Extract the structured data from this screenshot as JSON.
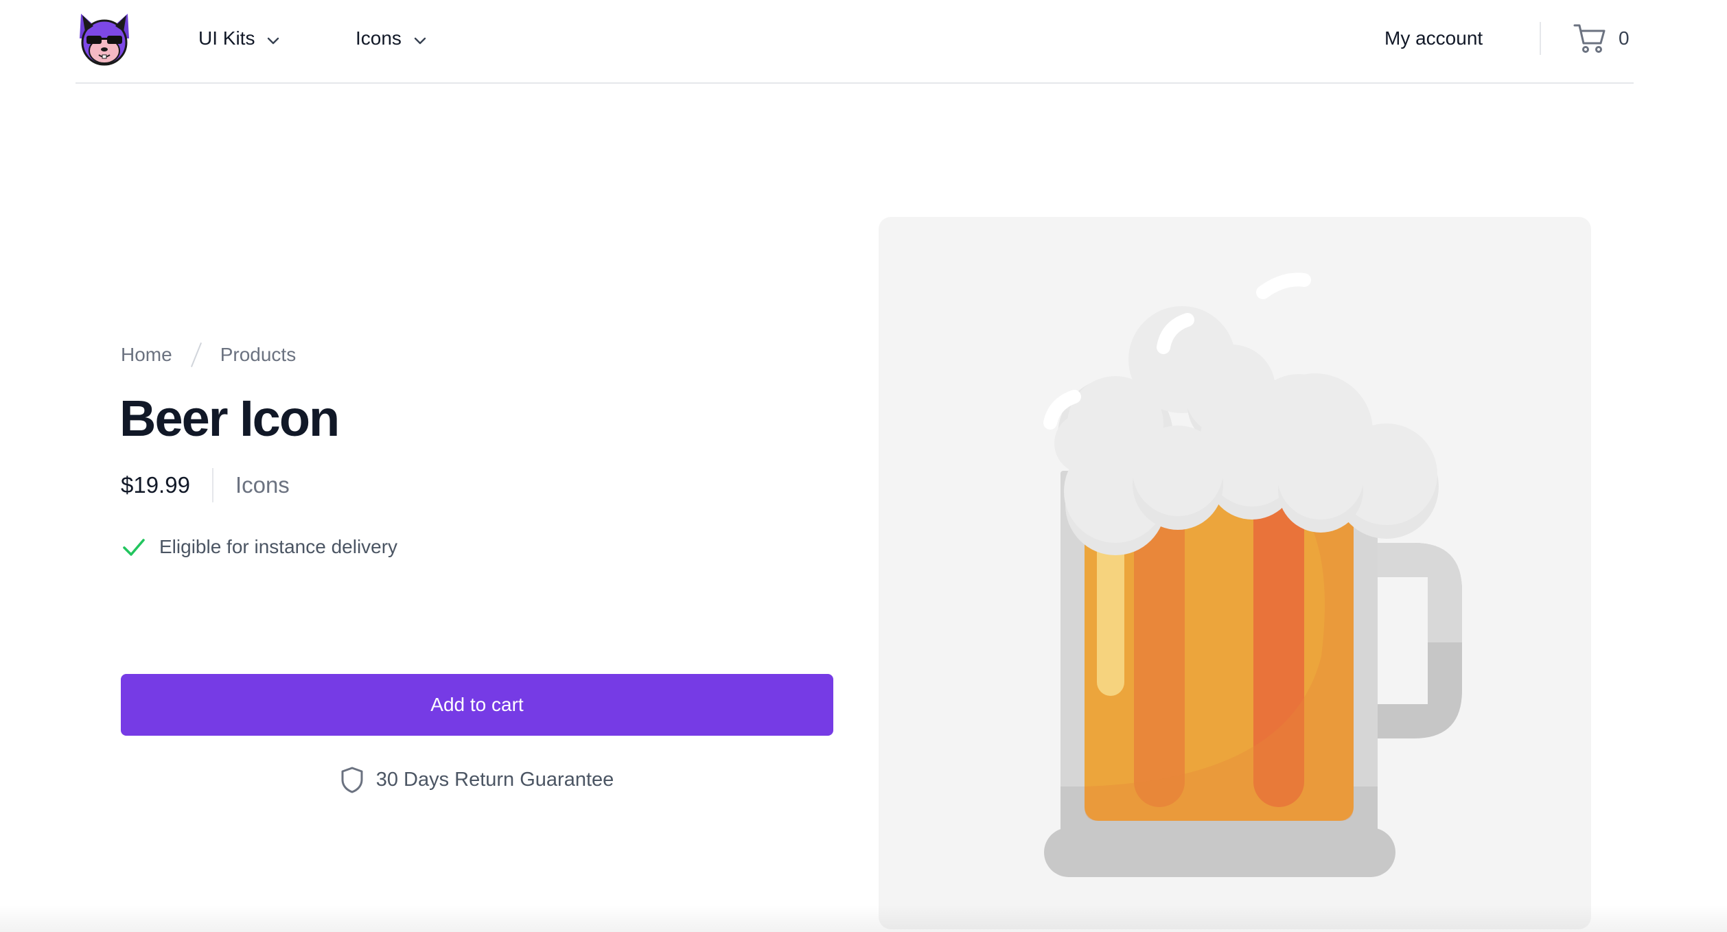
{
  "header": {
    "logo_icon": "cat-mascot-logo",
    "nav": [
      {
        "label": "UI Kits",
        "icon": "chevron-down-icon"
      },
      {
        "label": "Icons",
        "icon": "chevron-down-icon"
      }
    ],
    "account_label": "My account",
    "cart": {
      "icon": "cart-icon",
      "count": "0"
    }
  },
  "breadcrumb": [
    {
      "label": "Home"
    },
    {
      "label": "Products"
    }
  ],
  "product": {
    "title": "Beer Icon",
    "price": "$19.99",
    "category": "Icons",
    "delivery_text": "Eligible for instance delivery",
    "delivery_icon": "check-icon",
    "add_to_cart_label": "Add to cart",
    "guarantee_text": "30 Days Return Guarantee",
    "guarantee_icon": "shield-icon",
    "image_icon": "beer-mug-icon"
  },
  "colors": {
    "accent": "#763be5",
    "check": "#22c55e",
    "image_bg": "#f4f4f4",
    "beer_orange": "#eca53c",
    "beer_dark": "#e9873a",
    "foam": "#e8e8e8",
    "glass": "#d6d6d6"
  }
}
